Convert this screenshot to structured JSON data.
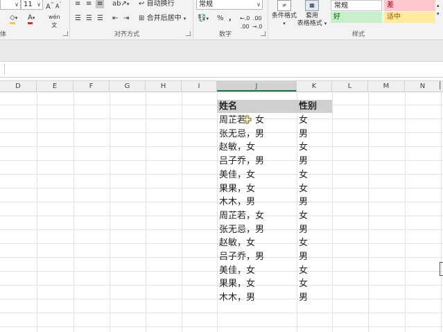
{
  "ribbon": {
    "font": {
      "size": "11",
      "grow_icon": "font-grow-icon",
      "shrink_icon": "font-shrink-icon",
      "group_label_fragment": "体",
      "fill_color": "#f5c242",
      "font_color": "#d0312d"
    },
    "alignment": {
      "wrap_label": "自动换行",
      "merge_label": "合并后居中",
      "group_label": "对齐方式"
    },
    "number": {
      "format_value": "常规",
      "percent_label": "%",
      "comma_label": ",",
      "group_label": "数字"
    },
    "styles": {
      "conditional_label": "条件格式",
      "table_label_1": "套用",
      "table_label_2": "表格格式",
      "group_label": "样式",
      "normal": "常规",
      "bad": "差",
      "good": "好",
      "neutral": "适中",
      "bad_color": "#ffc7ce",
      "good_color": "#c6efce",
      "neutral_color": "#ffeb9c"
    }
  },
  "sheet": {
    "columns": [
      "D",
      "E",
      "F",
      "G",
      "H",
      "I",
      "J",
      "K",
      "L",
      "M",
      "N"
    ],
    "active_column": "J",
    "header_name": "姓名",
    "header_gender": "性别",
    "header_fill": "#d0cece",
    "rows": [
      {
        "name": "周芷若，女",
        "gender": "女"
      },
      {
        "name": "张无忌，男",
        "gender": "男"
      },
      {
        "name": "赵敏，女",
        "gender": "女"
      },
      {
        "name": "吕子乔，男",
        "gender": "男"
      },
      {
        "name": "美佳，女",
        "gender": "女"
      },
      {
        "name": "果果，女",
        "gender": "女"
      },
      {
        "name": "木木，男",
        "gender": "男"
      },
      {
        "name": "周芷若，女",
        "gender": "女"
      },
      {
        "name": "张无忌，男",
        "gender": "男"
      },
      {
        "name": "赵敏，女",
        "gender": "女"
      },
      {
        "name": "吕子乔，男",
        "gender": "男"
      },
      {
        "name": "美佳，女",
        "gender": "女"
      },
      {
        "name": "果果，女",
        "gender": "女"
      },
      {
        "name": "木木，男",
        "gender": "男"
      }
    ]
  }
}
